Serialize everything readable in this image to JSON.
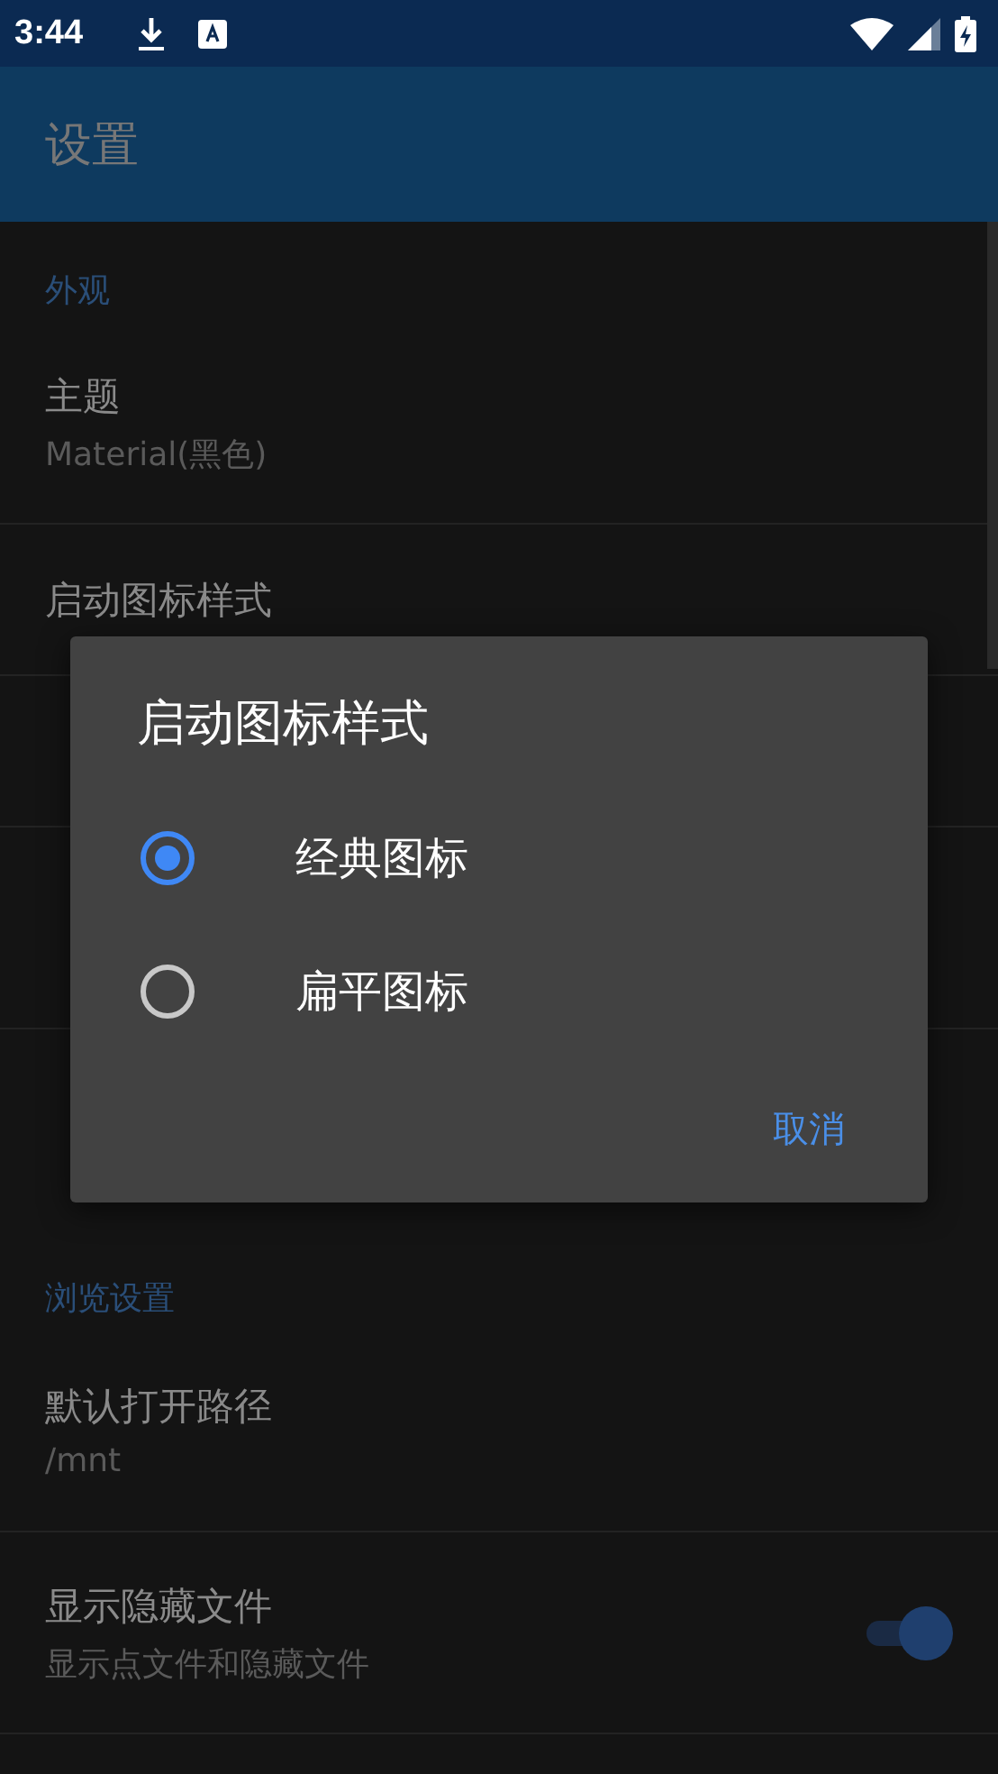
{
  "status_bar": {
    "time": "3:44"
  },
  "app_bar": {
    "title": "设置"
  },
  "sections": [
    {
      "header": "外观",
      "items": [
        {
          "kind": "text",
          "title": "主题",
          "subtitle": "Material(黑色)"
        },
        {
          "kind": "text",
          "title": "启动图标样式"
        },
        {
          "kind": "covered"
        },
        {
          "kind": "covered_two_line"
        }
      ]
    },
    {
      "header": "浏览设置",
      "items": [
        {
          "kind": "text",
          "title": "默认打开路径",
          "subtitle": "/mnt"
        },
        {
          "kind": "switch",
          "title": "显示隐藏文件",
          "subtitle": "显示点文件和隐藏文件",
          "on": true
        }
      ]
    }
  ],
  "dialog": {
    "title": "启动图标样式",
    "options": [
      {
        "label": "经典图标",
        "selected": true
      },
      {
        "label": "扁平图标",
        "selected": false
      }
    ],
    "buttons": [
      "取消"
    ]
  }
}
